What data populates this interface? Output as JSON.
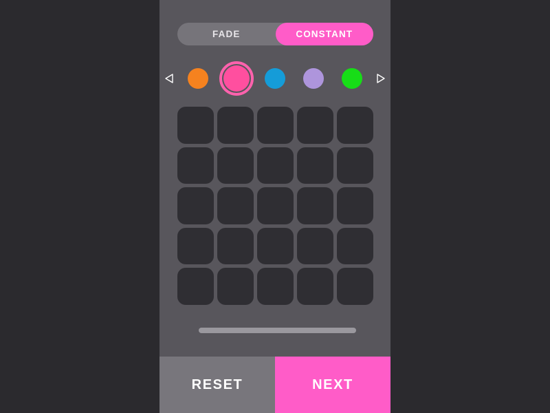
{
  "app": {
    "background_color": "#2b2a2e",
    "screen_color": "#58565c",
    "accent_color": "#ff5cc8"
  },
  "mode_toggle": {
    "options": [
      {
        "label": "FADE",
        "active": false
      },
      {
        "label": "CONSTANT",
        "active": true
      }
    ],
    "selected": "CONSTANT",
    "track_color": "#76747a",
    "active_color": "#ff5cc8"
  },
  "swatch_strip": {
    "prev_icon": "caret-left-icon",
    "next_icon": "caret-right-icon",
    "selected_index": 1,
    "selection_ring_color": "#ff62ad",
    "swatches": [
      {
        "name": "orange",
        "color": "#f5821f",
        "selected": false
      },
      {
        "name": "pink",
        "color": "#ff4f9f",
        "selected": true
      },
      {
        "name": "blue",
        "color": "#159cd8",
        "selected": false
      },
      {
        "name": "purple",
        "color": "#ae95dc",
        "selected": false
      },
      {
        "name": "green",
        "color": "#17dd17",
        "selected": false
      }
    ]
  },
  "tile_grid": {
    "columns": 5,
    "rows": 5,
    "tile_color": "#2f2e33",
    "tiles": [
      {
        "row": 0,
        "col": 0,
        "filled": false
      },
      {
        "row": 0,
        "col": 1,
        "filled": false
      },
      {
        "row": 0,
        "col": 2,
        "filled": false
      },
      {
        "row": 0,
        "col": 3,
        "filled": false
      },
      {
        "row": 0,
        "col": 4,
        "filled": false
      },
      {
        "row": 1,
        "col": 0,
        "filled": false
      },
      {
        "row": 1,
        "col": 1,
        "filled": false
      },
      {
        "row": 1,
        "col": 2,
        "filled": false
      },
      {
        "row": 1,
        "col": 3,
        "filled": false
      },
      {
        "row": 1,
        "col": 4,
        "filled": false
      },
      {
        "row": 2,
        "col": 0,
        "filled": false
      },
      {
        "row": 2,
        "col": 1,
        "filled": false
      },
      {
        "row": 2,
        "col": 2,
        "filled": false
      },
      {
        "row": 2,
        "col": 3,
        "filled": false
      },
      {
        "row": 2,
        "col": 4,
        "filled": false
      },
      {
        "row": 3,
        "col": 0,
        "filled": false
      },
      {
        "row": 3,
        "col": 1,
        "filled": false
      },
      {
        "row": 3,
        "col": 2,
        "filled": false
      },
      {
        "row": 3,
        "col": 3,
        "filled": false
      },
      {
        "row": 3,
        "col": 4,
        "filled": false
      },
      {
        "row": 4,
        "col": 0,
        "filled": false
      },
      {
        "row": 4,
        "col": 1,
        "filled": false
      },
      {
        "row": 4,
        "col": 2,
        "filled": false
      },
      {
        "row": 4,
        "col": 3,
        "filled": false
      },
      {
        "row": 4,
        "col": 4,
        "filled": false
      }
    ]
  },
  "slider": {
    "name": "brightness-slider",
    "track_color": "#9a989e",
    "value_percent": 100
  },
  "action_bar": {
    "reset_label": "RESET",
    "reset_color": "#78767c",
    "next_label": "NEXT",
    "next_color": "#ff5cc8"
  }
}
